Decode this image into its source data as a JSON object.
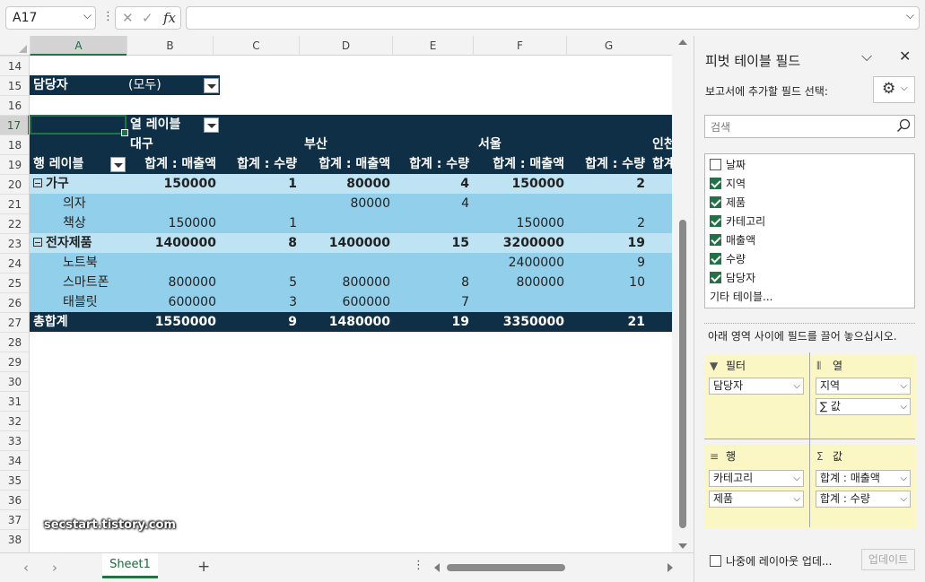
{
  "formula_bar": {
    "name_box": "A17",
    "dots": "⋮",
    "cancel_glyph": "✕",
    "enter_glyph": "✓",
    "fx_label": "fx",
    "formula": ""
  },
  "grid": {
    "columns": [
      "A",
      "B",
      "C",
      "D",
      "E",
      "F",
      "G"
    ],
    "rows": [
      "14",
      "15",
      "16",
      "17",
      "18",
      "19",
      "20",
      "21",
      "22",
      "23",
      "24",
      "25",
      "26",
      "27",
      "28",
      "29",
      "30",
      "31",
      "32",
      "33",
      "34",
      "35",
      "36",
      "37",
      "38"
    ],
    "selected_cell": "A17"
  },
  "pivot": {
    "filter_label": "담당자",
    "filter_value": "(모두)",
    "col_labels": "열 레이블",
    "row_labels": "행 레이블",
    "cities": [
      "대구",
      "부산",
      "서울",
      "인천"
    ],
    "measure_sales": "합계 : 매출액",
    "measure_qty": "합계 : 수량",
    "measure_partial": "합계",
    "rows": [
      {
        "label": "가구",
        "type": "group",
        "v": [
          "150000",
          "1",
          "80000",
          "4",
          "150000",
          "2"
        ]
      },
      {
        "label": "의자",
        "type": "item",
        "v": [
          "",
          "",
          "80000",
          "4",
          "",
          ""
        ]
      },
      {
        "label": "책상",
        "type": "item",
        "v": [
          "150000",
          "1",
          "",
          "",
          "150000",
          "2"
        ]
      },
      {
        "label": "전자제품",
        "type": "group",
        "v": [
          "1400000",
          "8",
          "1400000",
          "15",
          "3200000",
          "19"
        ]
      },
      {
        "label": "노트북",
        "type": "item",
        "v": [
          "",
          "",
          "",
          "",
          "2400000",
          "9"
        ]
      },
      {
        "label": "스마트폰",
        "type": "item",
        "v": [
          "800000",
          "5",
          "800000",
          "8",
          "800000",
          "10"
        ]
      },
      {
        "label": "태블릿",
        "type": "item",
        "v": [
          "600000",
          "3",
          "600000",
          "7",
          "",
          ""
        ]
      },
      {
        "label": "총합계",
        "type": "total",
        "v": [
          "1550000",
          "9",
          "1480000",
          "19",
          "3350000",
          "21"
        ]
      }
    ]
  },
  "watermark": "secstart.tistory.com",
  "sheet_tabs": {
    "active": "Sheet1",
    "add_label": "+",
    "prev": "‹",
    "next": "›",
    "dots": "⋮"
  },
  "panel": {
    "title": "피벗 테이블 필드",
    "subtitle": "보고서에 추가할 필드 선택:",
    "search_placeholder": "검색",
    "fields": [
      {
        "name": "날짜",
        "checked": false
      },
      {
        "name": "지역",
        "checked": true
      },
      {
        "name": "제품",
        "checked": true
      },
      {
        "name": "카테고리",
        "checked": true
      },
      {
        "name": "매출액",
        "checked": true
      },
      {
        "name": "수량",
        "checked": true
      },
      {
        "name": "담당자",
        "checked": true
      }
    ],
    "more_tables": "기타 테이블...",
    "instruction": "아래 영역 사이에 필드를 끌어 놓으십시오.",
    "areas": {
      "filter": {
        "title": "필터",
        "items": [
          "담당자"
        ]
      },
      "columns": {
        "title": "열",
        "items": [
          "지역",
          "∑ 값"
        ]
      },
      "rows": {
        "title": "행",
        "items": [
          "카테고리",
          "제품"
        ]
      },
      "values": {
        "title": "값",
        "items": [
          "합계 : 매출액",
          "합계 : 수량"
        ]
      }
    },
    "defer_label": "나중에 레이아웃 업데...",
    "update_button": "업데이트"
  }
}
